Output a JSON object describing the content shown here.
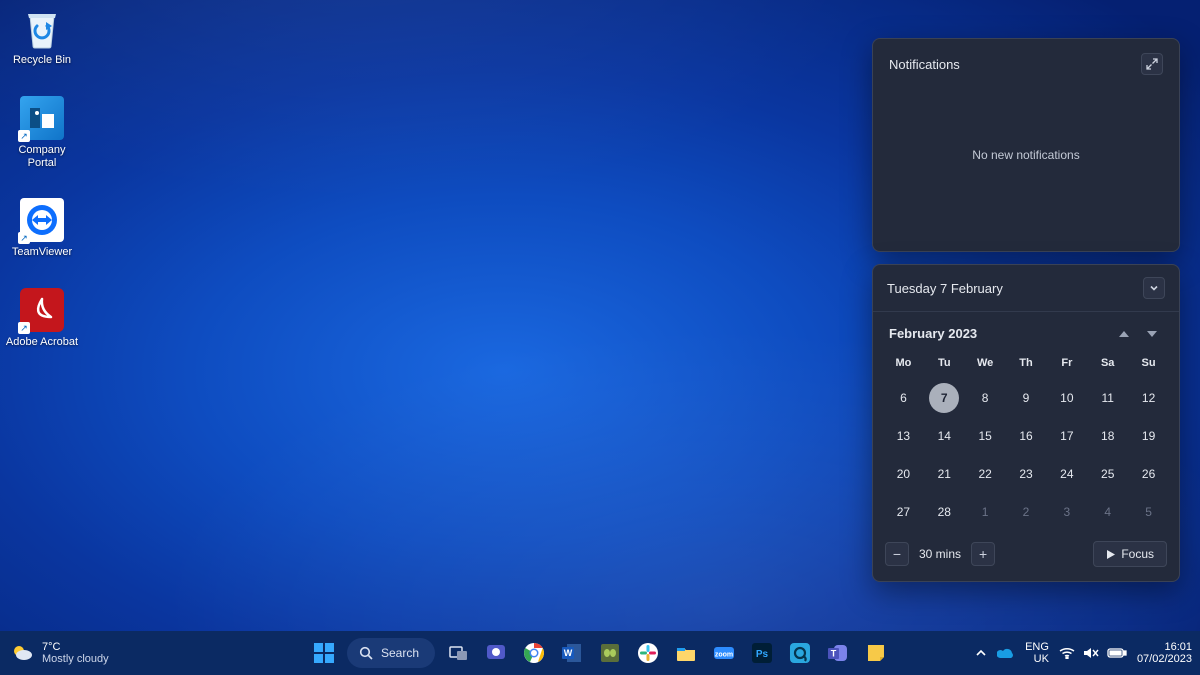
{
  "desktop_icons": [
    {
      "label": "Recycle Bin",
      "kind": "recycle"
    },
    {
      "label": "Company Portal",
      "kind": "portal"
    },
    {
      "label": "TeamViewer",
      "kind": "teamviewer"
    },
    {
      "label": "Adobe Acrobat",
      "kind": "acrobat"
    }
  ],
  "notifications": {
    "title": "Notifications",
    "empty_message": "No new notifications"
  },
  "calendar": {
    "header": "Tuesday 7 February",
    "month_label": "February 2023",
    "day_headers": [
      "Mo",
      "Tu",
      "We",
      "Th",
      "Fr",
      "Sa",
      "Su"
    ],
    "weeks": [
      [
        {
          "n": "6"
        },
        {
          "n": "7",
          "today": true
        },
        {
          "n": "8"
        },
        {
          "n": "9"
        },
        {
          "n": "10"
        },
        {
          "n": "11"
        },
        {
          "n": "12"
        }
      ],
      [
        {
          "n": "13"
        },
        {
          "n": "14"
        },
        {
          "n": "15"
        },
        {
          "n": "16"
        },
        {
          "n": "17"
        },
        {
          "n": "18"
        },
        {
          "n": "19"
        }
      ],
      [
        {
          "n": "20"
        },
        {
          "n": "21"
        },
        {
          "n": "22"
        },
        {
          "n": "23"
        },
        {
          "n": "24"
        },
        {
          "n": "25"
        },
        {
          "n": "26"
        }
      ],
      [
        {
          "n": "27"
        },
        {
          "n": "28"
        },
        {
          "n": "1",
          "dim": true
        },
        {
          "n": "2",
          "dim": true
        },
        {
          "n": "3",
          "dim": true
        },
        {
          "n": "4",
          "dim": true
        },
        {
          "n": "5",
          "dim": true
        }
      ]
    ],
    "focus": {
      "duration": "30 mins",
      "button": "Focus"
    }
  },
  "taskbar": {
    "weather": {
      "temp": "7°C",
      "cond": "Mostly cloudy"
    },
    "search_label": "Search",
    "apps": [
      "start",
      "search",
      "taskview",
      "teams-chat",
      "chrome",
      "word",
      "notepadpp",
      "slack",
      "explorer",
      "zoom",
      "photoshop",
      "snagit",
      "teams",
      "stickynotes"
    ],
    "tray": {
      "chevron": "^",
      "onedrive": true,
      "lang_top": "ENG",
      "lang_bottom": "UK",
      "wifi": true,
      "mute": true,
      "battery": true,
      "time": "16:01",
      "date": "07/02/2023"
    }
  }
}
